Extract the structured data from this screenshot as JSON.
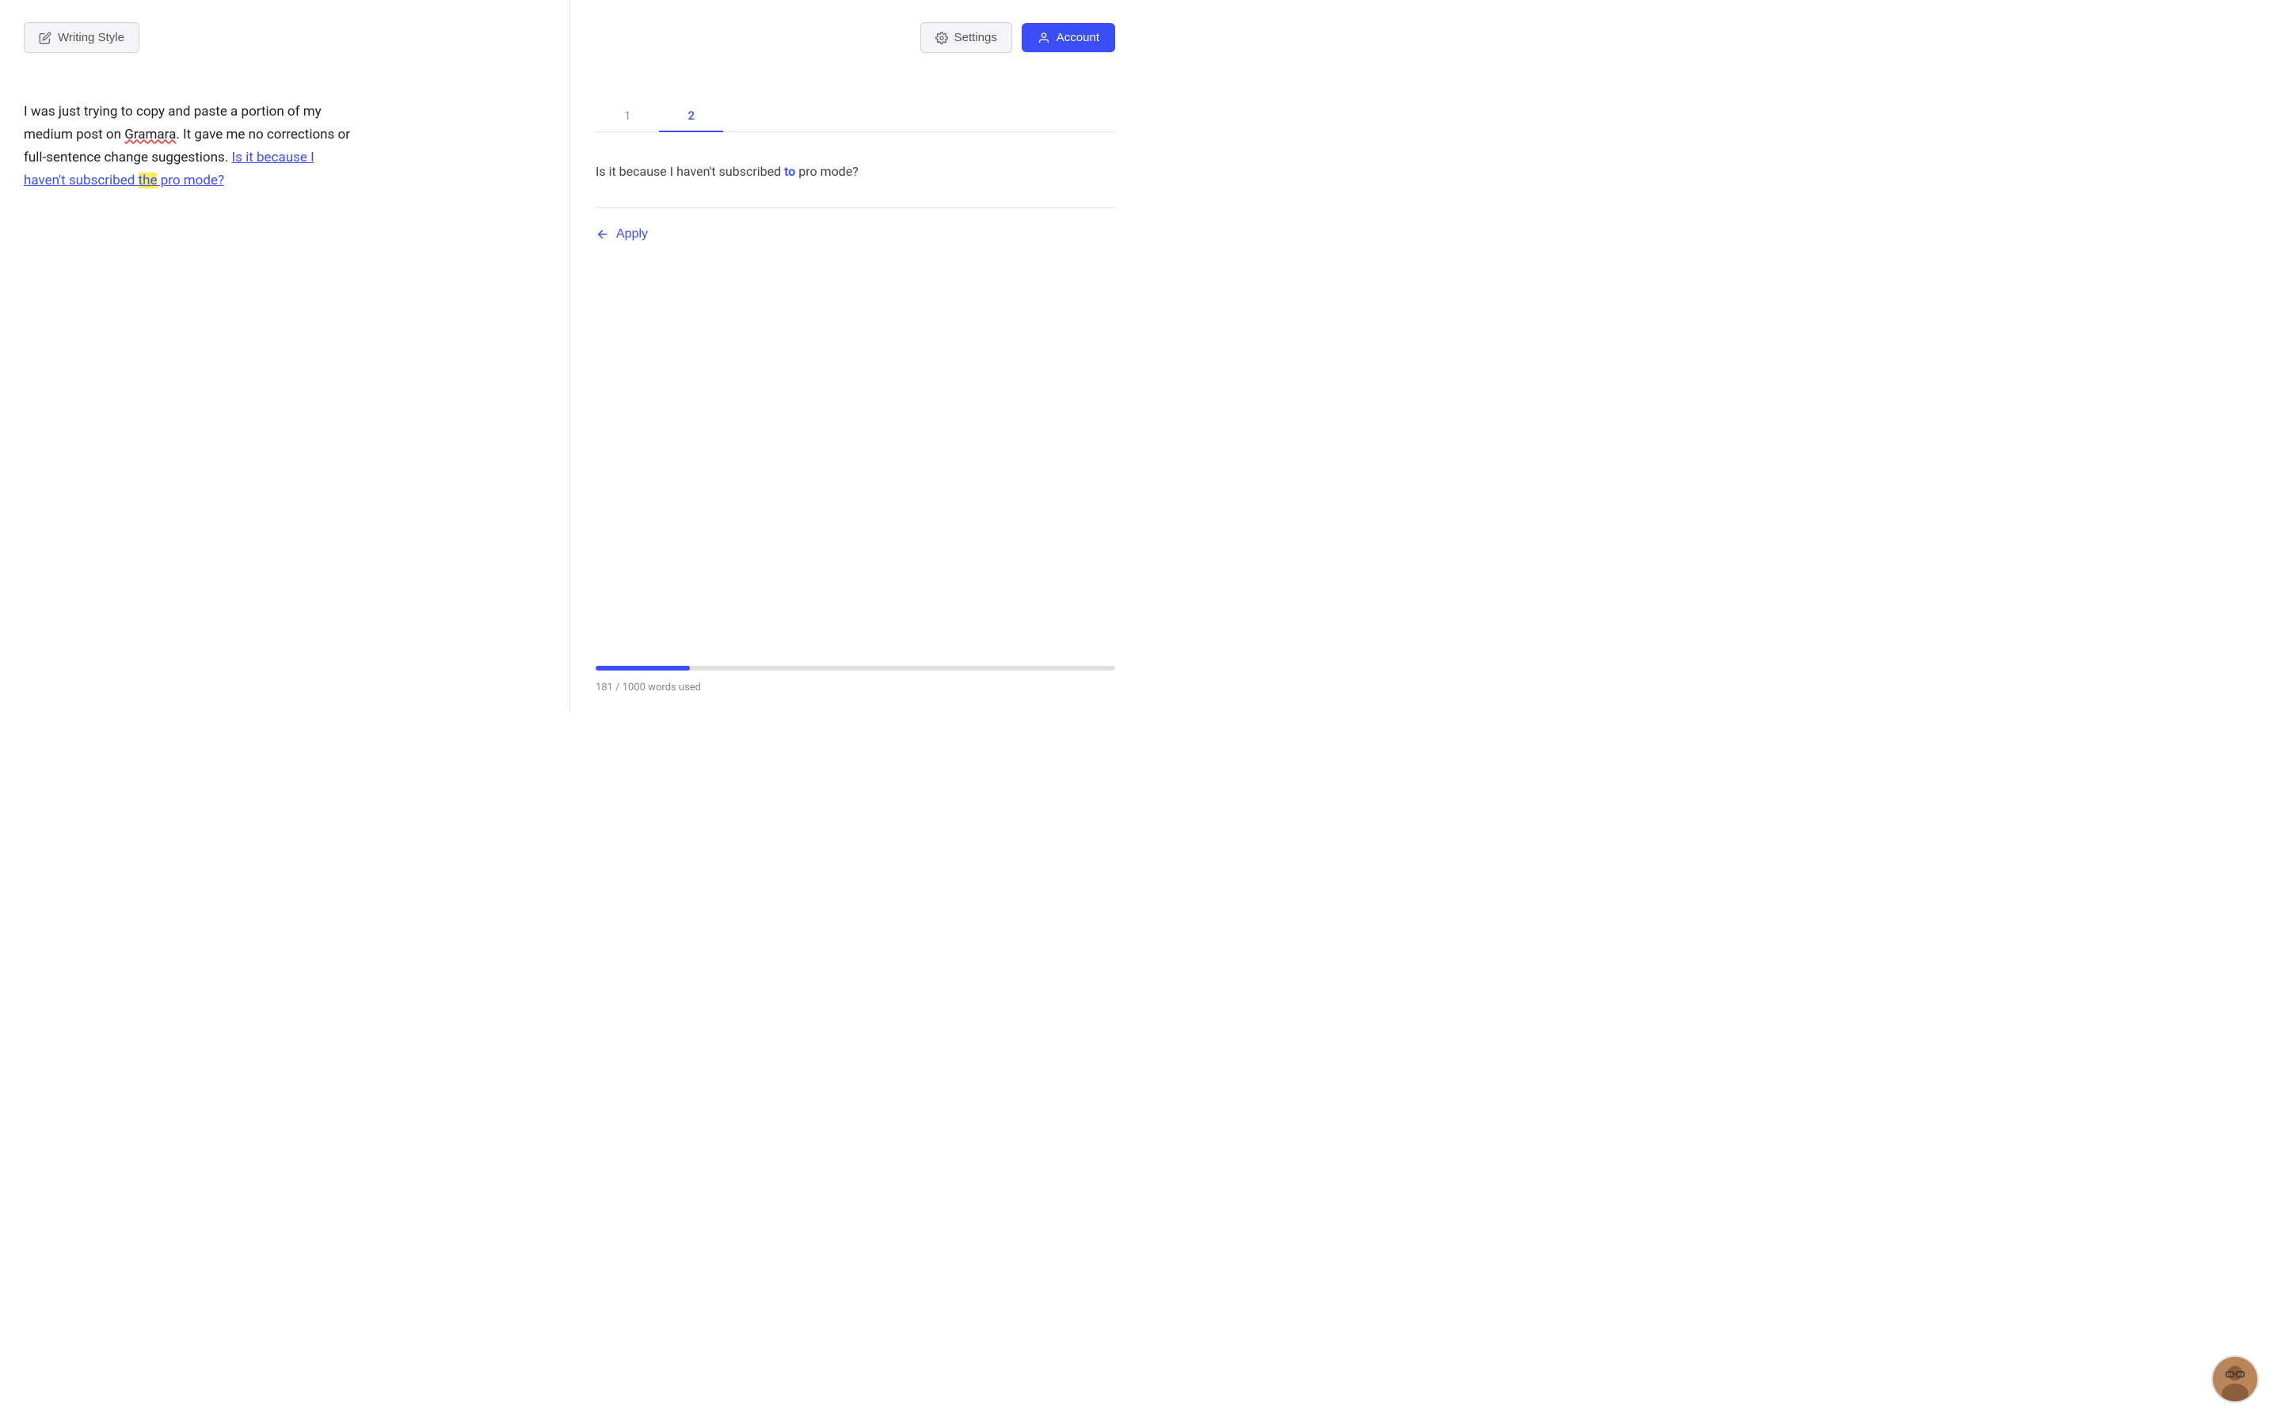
{
  "left": {
    "writing_style_label": "Writing Style",
    "writing_style_icon": "edit-icon",
    "text_paragraph1": "I was just trying to copy and paste a portion of my medium post on ",
    "text_gramara": "Gramara",
    "text_paragraph2": ". It gave me no corrections or full-sentence change suggestions. ",
    "text_link_before": "Is it because I haven't subscribed ",
    "text_link_highlight": "the",
    "text_link_after": "",
    "text_link2": "pro mode?",
    "link_full": "Is it because I haven't subscribed the pro mode?"
  },
  "right": {
    "settings_label": "Settings",
    "settings_icon": "gear-icon",
    "account_label": "Account",
    "account_icon": "person-icon",
    "tabs": [
      {
        "label": "1",
        "active": false
      },
      {
        "label": "2",
        "active": true
      }
    ],
    "suggestion_text_before": "Is it because I haven't subscribed ",
    "suggestion_highlight": "to",
    "suggestion_text_after": " pro mode?",
    "apply_label": "Apply",
    "apply_icon": "arrow-left-icon",
    "progress": {
      "used": 181,
      "total": 1000,
      "label": "181 / 1000 words used",
      "percent": 18.1
    }
  }
}
